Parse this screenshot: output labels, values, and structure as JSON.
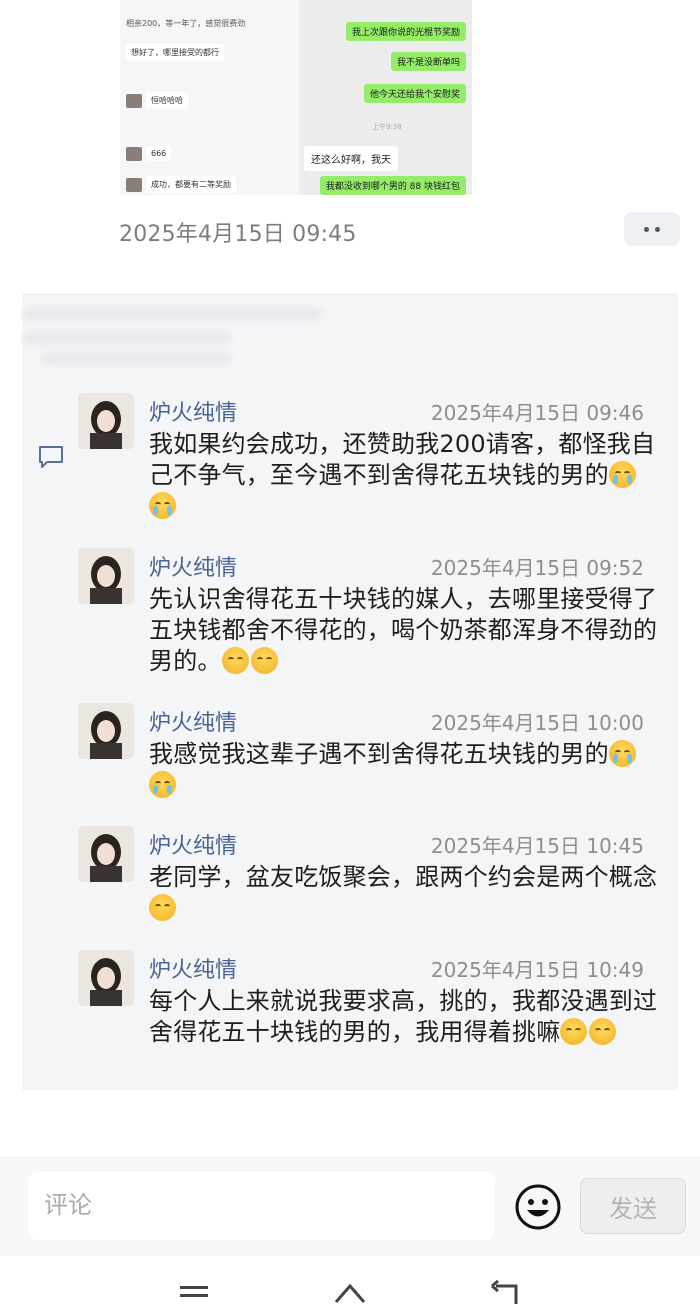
{
  "post": {
    "image": {
      "left_rows": [
        "相亲200，等一年了，感觉很费劲",
        "想好了，哪里接受的都行",
        "恒哈哈哈",
        "666",
        "成功，都要有二等奖励"
      ],
      "right_bubbles": [
        "我上次跟你说的光棍节奖励",
        "我不是没断单吗",
        "他今天还给我个安慰奖",
        "还这么好啊，我天",
        "我都没收到哪个男的 88 块钱红包"
      ],
      "right_time": "上午9:38"
    },
    "time": "2025年4月15日 09:45"
  },
  "comments": [
    {
      "name": "炉火纯情",
      "time": "2025年4月15日 09:46",
      "text": "我如果约会成功，还赞助我200请客，都怪我自己不争气，至今遇不到舍得花五块钱的男的",
      "emojis": [
        "crying-face",
        "crying-face"
      ]
    },
    {
      "name": "炉火纯情",
      "time": "2025年4月15日 09:52",
      "text": "先认识舍得花五十块钱的媒人，去哪里接受得了五块钱都舍不得花的，喝个奶茶都浑身不得劲的男的。",
      "emojis": [
        "grimace-face",
        "grimace-face"
      ]
    },
    {
      "name": "炉火纯情",
      "time": "2025年4月15日 10:00",
      "text": "我感觉我这辈子遇不到舍得花五块钱的男的",
      "emojis": [
        "crying-face",
        "crying-face"
      ]
    },
    {
      "name": "炉火纯情",
      "time": "2025年4月15日 10:45",
      "text": "老同学，盆友吃饭聚会，跟两个约会是两个概念",
      "emojis": [
        "flushed-face"
      ]
    },
    {
      "name": "炉火纯情",
      "time": "2025年4月15日 10:49",
      "text": "每个人上来就说我要求高，挑的，我都没遇到过舍得花五十块钱的男的，我用得着挑嘛",
      "emojis": [
        "unamused-face",
        "unamused-face"
      ]
    }
  ],
  "input": {
    "placeholder": "评论",
    "send_label": "发送"
  },
  "icons": {
    "more": "more-dots-icon",
    "comment": "comment-bubble-icon",
    "emoji": "smiley-icon",
    "nav": [
      "menu-icon",
      "home-icon",
      "back-icon"
    ]
  }
}
